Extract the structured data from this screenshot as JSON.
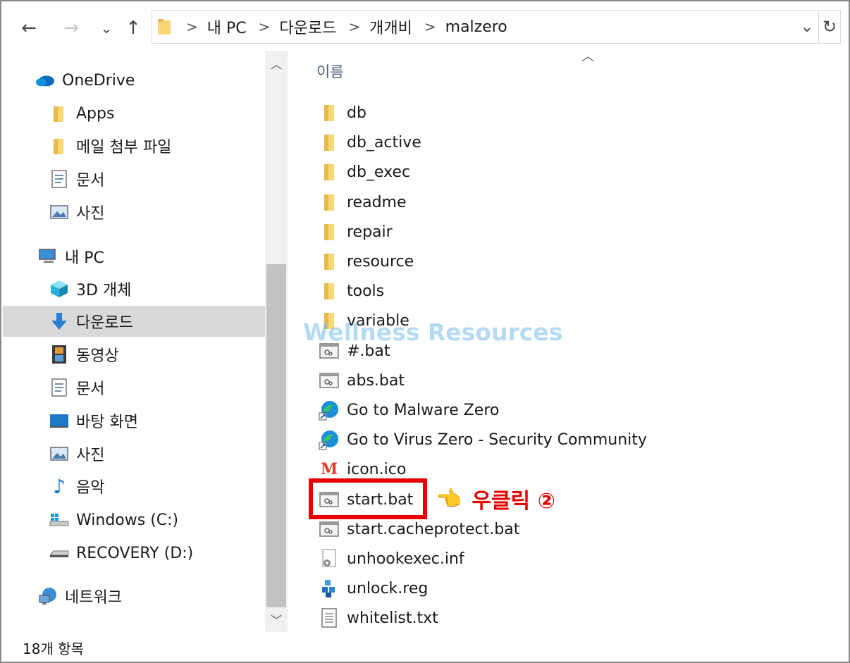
{
  "address": {
    "crumbs": [
      "내 PC",
      "다운로드",
      "개개비",
      "malzero"
    ],
    "separator": ">"
  },
  "nav_buttons": {
    "back": "←",
    "forward": "→",
    "recent": "⌄",
    "up": "↑",
    "address_dropdown": "⌄",
    "refresh": "↻"
  },
  "sidebar": {
    "items": [
      {
        "label": "OneDrive",
        "icon": "cloud-icon"
      },
      {
        "label": "Apps",
        "icon": "folder-icon"
      },
      {
        "label": "메일 첨부 파일",
        "icon": "folder-icon"
      },
      {
        "label": "문서",
        "icon": "document-icon"
      },
      {
        "label": "사진",
        "icon": "pictures-icon"
      },
      {
        "label": "내 PC",
        "icon": "computer-icon"
      },
      {
        "label": "3D 개체",
        "icon": "cube-icon"
      },
      {
        "label": "다운로드",
        "icon": "download-arrow-icon",
        "selected": true
      },
      {
        "label": "동영상",
        "icon": "film-icon"
      },
      {
        "label": "문서",
        "icon": "document-icon"
      },
      {
        "label": "바탕 화면",
        "icon": "desktop-icon"
      },
      {
        "label": "사진",
        "icon": "pictures-icon"
      },
      {
        "label": "음악",
        "icon": "music-note-icon"
      },
      {
        "label": "Windows (C:)",
        "icon": "windows-drive-icon"
      },
      {
        "label": "RECOVERY (D:)",
        "icon": "drive-icon"
      },
      {
        "label": "네트워크",
        "icon": "network-icon"
      }
    ]
  },
  "content": {
    "column_header": "이름",
    "files": [
      {
        "name": "db",
        "icon": "folder-icon"
      },
      {
        "name": "db_active",
        "icon": "folder-icon"
      },
      {
        "name": "db_exec",
        "icon": "folder-icon"
      },
      {
        "name": "readme",
        "icon": "folder-icon"
      },
      {
        "name": "repair",
        "icon": "folder-icon"
      },
      {
        "name": "resource",
        "icon": "folder-icon"
      },
      {
        "name": "tools",
        "icon": "folder-icon"
      },
      {
        "name": "variable",
        "icon": "folder-icon"
      },
      {
        "name": "#.bat",
        "icon": "batch-file-icon"
      },
      {
        "name": "abs.bat",
        "icon": "batch-file-icon"
      },
      {
        "name": "Go to Malware Zero",
        "icon": "edge-shortcut-icon"
      },
      {
        "name": "Go to Virus Zero - Security Community",
        "icon": "edge-shortcut-icon"
      },
      {
        "name": "icon.ico",
        "icon": "m-logo-icon"
      },
      {
        "name": "start.bat",
        "icon": "batch-file-icon",
        "highlighted": true
      },
      {
        "name": "start.cacheprotect.bat",
        "icon": "batch-file-icon"
      },
      {
        "name": "unhookexec.inf",
        "icon": "settings-file-icon"
      },
      {
        "name": "unlock.reg",
        "icon": "registry-file-icon"
      },
      {
        "name": "whitelist.txt",
        "icon": "text-file-icon"
      }
    ]
  },
  "annotation": {
    "text": "우클릭 ②",
    "pointer": "👈",
    "color": "#e60000"
  },
  "watermark": "Wellness Resources",
  "status": {
    "item_count": "18개 항목"
  },
  "colors": {
    "selected_bg": "#d9d9d9",
    "folder": "#f8d774",
    "highlight": "#e60000"
  }
}
